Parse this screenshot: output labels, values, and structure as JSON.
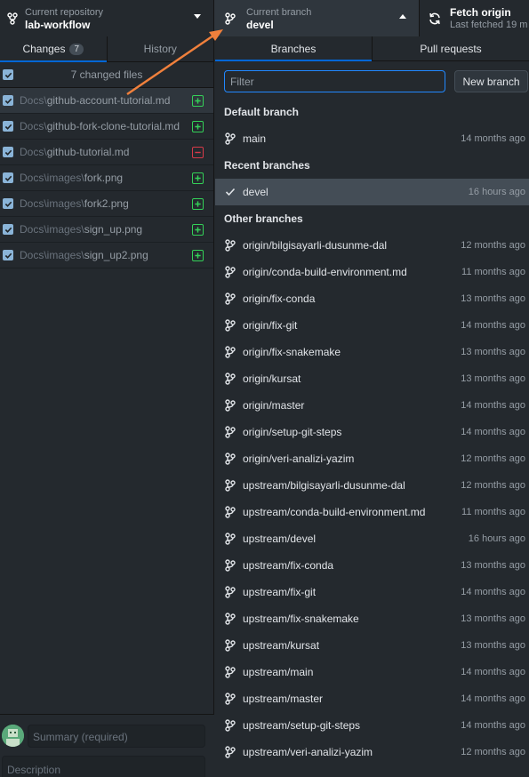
{
  "toolbar": {
    "repo": {
      "label": "Current repository",
      "value": "lab-workflow"
    },
    "branch": {
      "label": "Current branch",
      "value": "devel"
    },
    "fetch": {
      "label": "Fetch origin",
      "value": "Last fetched 19 m"
    }
  },
  "left_tabs": {
    "changes": "Changes",
    "changes_count": "7",
    "history": "History"
  },
  "files_header": "7 changed files",
  "files": [
    {
      "dir": "Docs\\",
      "name": "github-account-tutorial.md",
      "status": "added"
    },
    {
      "dir": "Docs\\",
      "name": "github-fork-clone-tutorial.md",
      "status": "added"
    },
    {
      "dir": "Docs\\",
      "name": "github-tutorial.md",
      "status": "deleted"
    },
    {
      "dir": "Docs\\images\\",
      "name": "fork.png",
      "status": "added"
    },
    {
      "dir": "Docs\\images\\",
      "name": "fork2.png",
      "status": "added"
    },
    {
      "dir": "Docs\\images\\",
      "name": "sign_up.png",
      "status": "added"
    },
    {
      "dir": "Docs\\images\\",
      "name": "sign_up2.png",
      "status": "added"
    }
  ],
  "commit": {
    "summary_placeholder": "Summary (required)",
    "description_placeholder": "Description"
  },
  "right_tabs": {
    "branches": "Branches",
    "pull_requests": "Pull requests"
  },
  "filter_placeholder": "Filter",
  "new_branch_label": "New branch",
  "groups": {
    "default": {
      "title": "Default branch",
      "branches": [
        {
          "name": "main",
          "time": "14 months ago"
        }
      ]
    },
    "recent": {
      "title": "Recent branches",
      "branches": [
        {
          "name": "devel",
          "time": "16 hours ago"
        }
      ]
    },
    "other": {
      "title": "Other branches",
      "branches": [
        {
          "name": "origin/bilgisayarli-dusunme-dal",
          "time": "12 months ago"
        },
        {
          "name": "origin/conda-build-environment.md",
          "time": "11 months ago"
        },
        {
          "name": "origin/fix-conda",
          "time": "13 months ago"
        },
        {
          "name": "origin/fix-git",
          "time": "14 months ago"
        },
        {
          "name": "origin/fix-snakemake",
          "time": "13 months ago"
        },
        {
          "name": "origin/kursat",
          "time": "13 months ago"
        },
        {
          "name": "origin/master",
          "time": "14 months ago"
        },
        {
          "name": "origin/setup-git-steps",
          "time": "14 months ago"
        },
        {
          "name": "origin/veri-analizi-yazim",
          "time": "12 months ago"
        },
        {
          "name": "upstream/bilgisayarli-dusunme-dal",
          "time": "12 months ago"
        },
        {
          "name": "upstream/conda-build-environment.md",
          "time": "11 months ago"
        },
        {
          "name": "upstream/devel",
          "time": "16 hours ago"
        },
        {
          "name": "upstream/fix-conda",
          "time": "13 months ago"
        },
        {
          "name": "upstream/fix-git",
          "time": "14 months ago"
        },
        {
          "name": "upstream/fix-snakemake",
          "time": "13 months ago"
        },
        {
          "name": "upstream/kursat",
          "time": "13 months ago"
        },
        {
          "name": "upstream/main",
          "time": "14 months ago"
        },
        {
          "name": "upstream/master",
          "time": "14 months ago"
        },
        {
          "name": "upstream/setup-git-steps",
          "time": "14 months ago"
        },
        {
          "name": "upstream/veri-analizi-yazim",
          "time": "12 months ago"
        }
      ]
    }
  },
  "colors": {
    "accent": "#0366d6",
    "annotation_arrow": "#f0803c",
    "added": "#34d058",
    "deleted": "#d73a49"
  }
}
